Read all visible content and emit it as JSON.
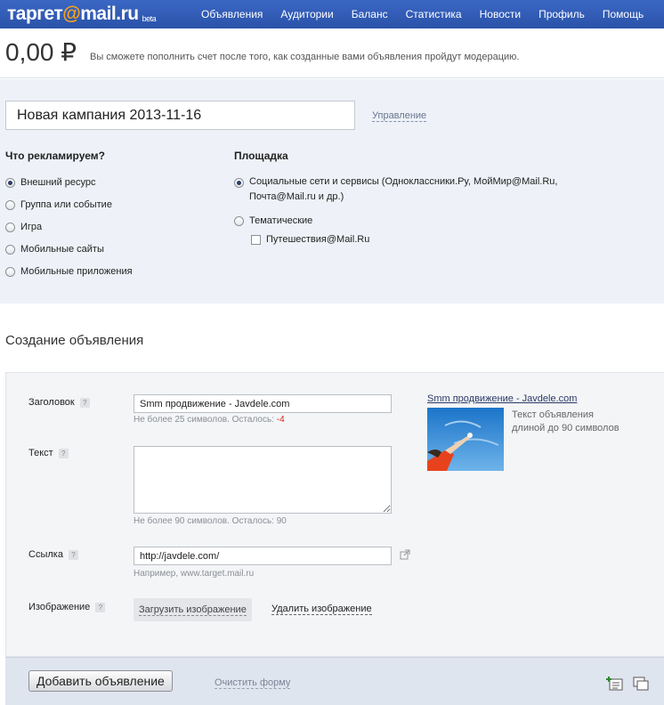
{
  "header": {
    "logo_main": "таргет",
    "logo_at": "@",
    "logo_mail": "mail.ru",
    "logo_beta": "beta",
    "nav": [
      "Объявления",
      "Аудитории",
      "Баланс",
      "Статистика",
      "Новости",
      "Профиль",
      "Помощь"
    ]
  },
  "balance": {
    "amount": "0,00 ₽",
    "note": "Вы сможете пополнить счет после того, как созданные вами объявления пройдут модерацию."
  },
  "campaign": {
    "name": "Новая кампания 2013-11-16",
    "manage_label": "Управление",
    "what_title": "Что рекламируем?",
    "what_options": [
      {
        "label": "Внешний ресурс",
        "checked": true
      },
      {
        "label": "Группа или событие",
        "checked": false
      },
      {
        "label": "Игра",
        "checked": false
      },
      {
        "label": "Мобильные сайты",
        "checked": false
      },
      {
        "label": "Мобильные приложения",
        "checked": false
      }
    ],
    "platform_title": "Площадка",
    "platform_social": "Социальные сети и сервисы (Одноклассники.Ру, МойМир@Mail.Ru, Почта@Mail.ru и др.)",
    "platform_thematic": "Тематические",
    "platform_travel": "Путешествия@Mail.Ru"
  },
  "ad": {
    "section_title": "Создание объявления",
    "title_label": "Заголовок",
    "title_value": "Smm продвижение - Javdele.com",
    "title_hint": "Не более 25 символов. Осталось: ",
    "title_remaining": "-4",
    "text_label": "Текст",
    "text_hint": "Не более 90 символов. Осталось: 90",
    "link_label": "Ссылка",
    "link_value": "http://javdele.com/",
    "link_hint": "Например, www.target.mail.ru",
    "image_label": "Изображение",
    "upload_label": "Загрузить изображение",
    "delete_label": "Удалить изображение",
    "help_mark": "?",
    "preview_title": "Smm продвижение - Javdele.com",
    "preview_text_line1": "Текст объявления",
    "preview_text_line2": "длиной до 90 символов"
  },
  "footer": {
    "add_label": "Добавить объявление",
    "clear_label": "Очистить форму"
  },
  "colors": {
    "header_bg": "#2f5bb7",
    "logo_at": "#f7a21b",
    "panel_bg": "#eef2f8",
    "warning": "#dd2222"
  }
}
